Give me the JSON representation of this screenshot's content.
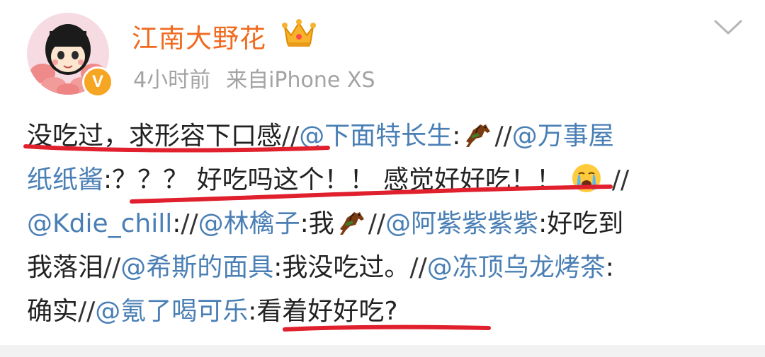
{
  "post": {
    "username": "江南大野花",
    "time": "4小时前",
    "source": "来自iPhone XS",
    "verified_mark": "V",
    "lines": [
      [
        {
          "type": "text",
          "text": "没吃过，求形容下口感"
        },
        {
          "type": "slash",
          "text": "//"
        },
        {
          "type": "mention",
          "text": "@下面特长生"
        },
        {
          "type": "text",
          "text": ":"
        },
        {
          "type": "emoji",
          "name": "horse-emoji"
        },
        {
          "type": "slash",
          "text": "//"
        },
        {
          "type": "mention",
          "text": "@万事屋"
        }
      ],
      [
        {
          "type": "mention",
          "text": "纸纸酱"
        },
        {
          "type": "text",
          "text": ":？？？ 好吃吗这个！！ 感觉好好吃！！ "
        },
        {
          "type": "emoji",
          "name": "crying-face-emoji"
        },
        {
          "type": "slash",
          "text": " //"
        }
      ],
      [
        {
          "type": "mention",
          "text": "@Kdie_chill"
        },
        {
          "type": "text",
          "text": ":"
        },
        {
          "type": "slash",
          "text": "//"
        },
        {
          "type": "mention",
          "text": "@林檎子"
        },
        {
          "type": "text",
          "text": ":我"
        },
        {
          "type": "emoji",
          "name": "horse-emoji"
        },
        {
          "type": "slash",
          "text": "//"
        },
        {
          "type": "mention",
          "text": "@阿紫紫紫紫"
        },
        {
          "type": "text",
          "text": ":好吃到"
        }
      ],
      [
        {
          "type": "text",
          "text": "我落泪"
        },
        {
          "type": "slash",
          "text": "//"
        },
        {
          "type": "mention",
          "text": "@希斯的面具"
        },
        {
          "type": "text",
          "text": ":我没吃过。"
        },
        {
          "type": "slash",
          "text": "//"
        },
        {
          "type": "mention",
          "text": "@冻顶乌龙烤茶"
        },
        {
          "type": "text",
          "text": ":"
        }
      ],
      [
        {
          "type": "text",
          "text": "确实"
        },
        {
          "type": "slash",
          "text": "//"
        },
        {
          "type": "mention",
          "text": "@氪了喝可乐"
        },
        {
          "type": "text",
          "text": ":看着好好吃?"
        }
      ]
    ]
  },
  "icons": {
    "crown": "crown-icon",
    "chevron": "chevron-down-icon",
    "badge": "verified-badge-icon"
  },
  "colors": {
    "username": "#f06a1f",
    "mention": "#4a7fb5",
    "meta": "#a3a3a3",
    "text": "#222222",
    "underline": "#e0202d",
    "badge": "#f6a623"
  }
}
